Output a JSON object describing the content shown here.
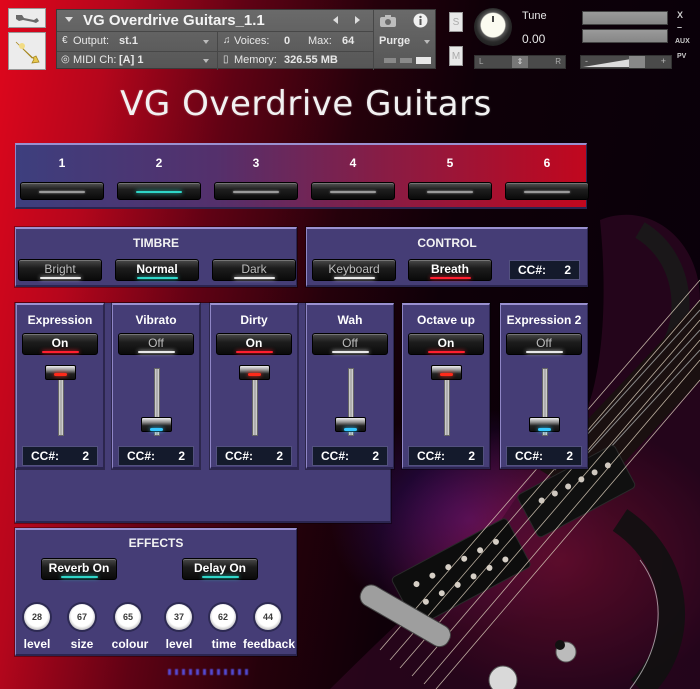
{
  "header": {
    "instrument_name": "VG Overdrive Guitars_1.1",
    "output_label": "Output:",
    "output_value": "st.1",
    "midi_label": "MIDI Ch:",
    "midi_value": "[A] 1",
    "voices_label": "Voices:",
    "voices_value": "0",
    "max_label": "Max:",
    "max_value": "64",
    "memory_label": "Memory:",
    "memory_value": "326.55 MB",
    "purge_label": "Purge",
    "solo_label": "S",
    "mute_label": "M",
    "tune_label": "Tune",
    "tune_value": "0.00",
    "pan_left": "L",
    "pan_right": "R",
    "vol_minus": "-",
    "vol_plus": "+",
    "close_label": "X",
    "minimize_label": "–",
    "aux_label": "AUX",
    "pv_label": "PV",
    "icons": {
      "tool": "wrench-icon",
      "instrument": "trumpet-icon",
      "snapshot": "camera-icon",
      "info": "info-icon"
    }
  },
  "title": "VG Overdrive Guitars",
  "presets": {
    "items": [
      {
        "label": "1",
        "active": false
      },
      {
        "label": "2",
        "active": true
      },
      {
        "label": "3",
        "active": false
      },
      {
        "label": "4",
        "active": false
      },
      {
        "label": "5",
        "active": false
      },
      {
        "label": "6",
        "active": false
      }
    ]
  },
  "timbre": {
    "title": "TIMBRE",
    "options": [
      "Bright",
      "Normal",
      "Dark"
    ],
    "selected": "Normal"
  },
  "control": {
    "title": "CONTROL",
    "options": [
      "Keyboard",
      "Breath"
    ],
    "selected": "Breath",
    "cc_label": "CC#:",
    "cc_value": "2"
  },
  "modules": [
    {
      "title": "Expression",
      "state": "On",
      "fader": 1.0,
      "cc_label": "CC#:",
      "cc_value": "2"
    },
    {
      "title": "Vibrato",
      "state": "Off",
      "fader": 0.0,
      "cc_label": "CC#:",
      "cc_value": "2"
    },
    {
      "title": "Dirty",
      "state": "On",
      "fader": 1.0,
      "cc_label": "CC#:",
      "cc_value": "2"
    },
    {
      "title": "Wah",
      "state": "Off",
      "fader": 0.0,
      "cc_label": "CC#:",
      "cc_value": "2"
    },
    {
      "title": "Octave up",
      "state": "On",
      "fader": 1.0,
      "cc_label": "CC#:",
      "cc_value": "2"
    },
    {
      "title": "Expression 2",
      "state": "Off",
      "fader": 0.0,
      "cc_label": "CC#:",
      "cc_value": "2"
    }
  ],
  "effects": {
    "title": "EFFECTS",
    "reverb_label": "Reverb On",
    "delay_label": "Delay On",
    "knobs": [
      {
        "label": "level",
        "value": "28"
      },
      {
        "label": "size",
        "value": "67"
      },
      {
        "label": "colour",
        "value": "65"
      },
      {
        "label": "level",
        "value": "37"
      },
      {
        "label": "time",
        "value": "62"
      },
      {
        "label": "feedback",
        "value": "44"
      }
    ]
  },
  "colors": {
    "panel": "#453d76",
    "glow_teal": "#2fd6c8",
    "glow_red": "#ff1f2f",
    "glow_white": "#e9e9e9",
    "led_blue": "#36c8ff",
    "led_red": "#ff2a1a"
  }
}
